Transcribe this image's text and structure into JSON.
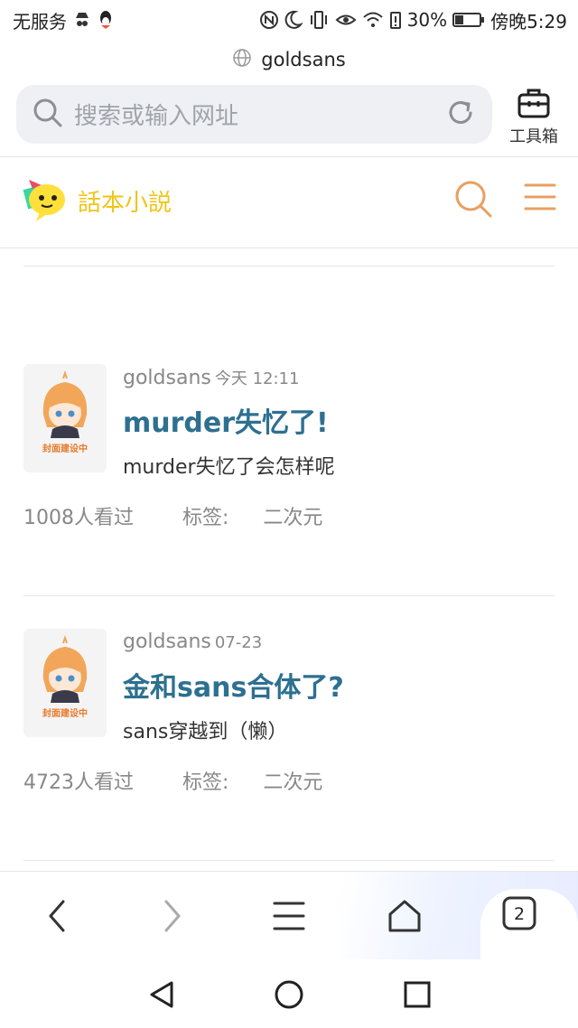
{
  "status_bar": {
    "carrier": "无服务",
    "battery": "30%",
    "time": "傍晚5:29"
  },
  "browser": {
    "domain": "goldsans",
    "search_placeholder": "搜索或输入网址",
    "toolbox_label": "工具箱",
    "tab_count": "2"
  },
  "site": {
    "logo_text": "話本小説",
    "accent_color": "#e8a060"
  },
  "articles": [
    {
      "author": "goldsans",
      "time": "今天 12:11",
      "title": "murder失忆了!",
      "summary": "murder失忆了会怎样呢",
      "views": "1008人看过",
      "tag_label": "标签:",
      "tag": "二次元",
      "cover_text": "封面建设中"
    },
    {
      "author": "goldsans",
      "time": "07-23",
      "title": "金和sans合体了?",
      "summary": "sans穿越到（懒）",
      "views": "4723人看过",
      "tag_label": "标签:",
      "tag": "二次元",
      "cover_text": "封面建设中"
    }
  ]
}
